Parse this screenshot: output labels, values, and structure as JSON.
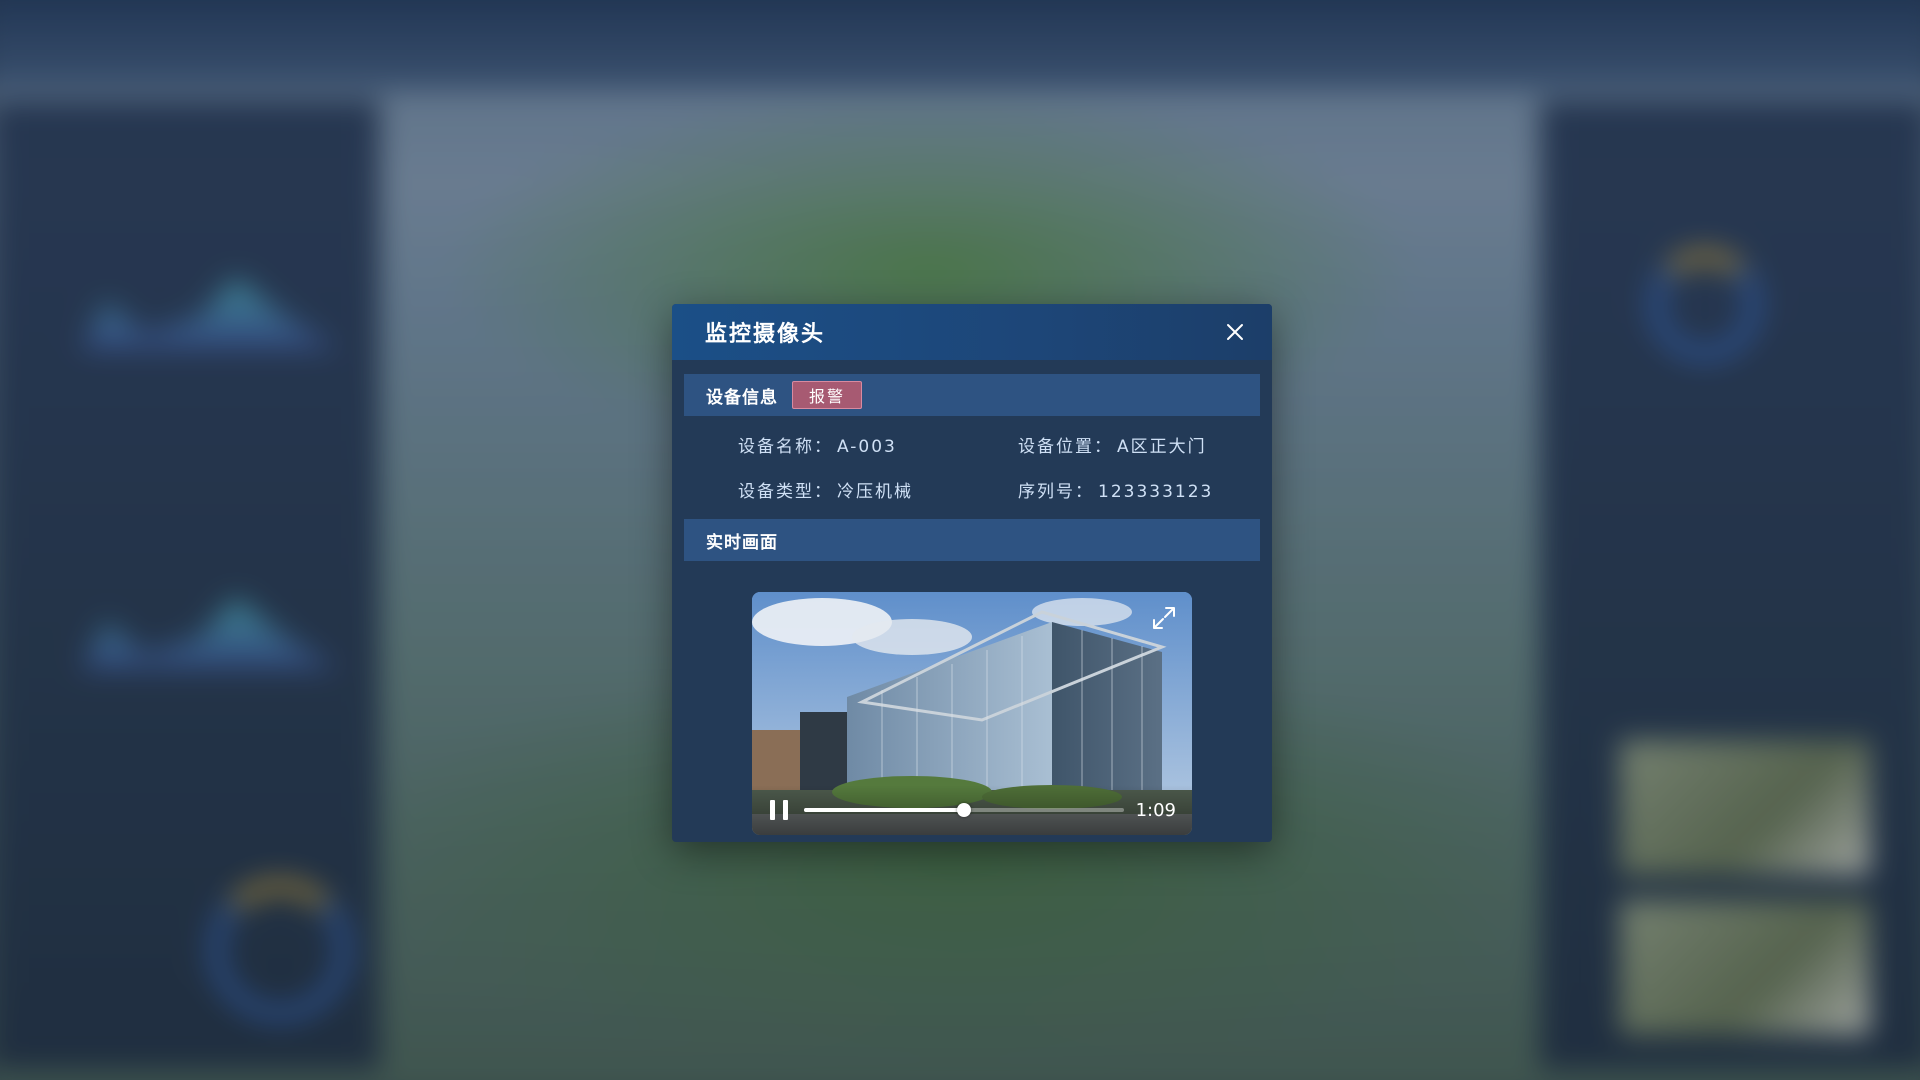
{
  "modal": {
    "title": "监控摄像头",
    "close_icon": "close-icon"
  },
  "device_info": {
    "section_label": "设备信息",
    "status_badge": "报警",
    "status_color": "#a75a72",
    "fields": {
      "name_label": "设备名称：",
      "name_value": "A-003",
      "location_label": "设备位置：",
      "location_value": "A区正大门",
      "type_label": "设备类型：",
      "type_value": "冷压机械",
      "serial_label": "序列号：",
      "serial_value": "123333123"
    }
  },
  "live_view": {
    "section_label": "实时画面",
    "player": {
      "state": "playing",
      "pause_icon": "pause-icon",
      "fullscreen_icon": "fullscreen-icon",
      "progress_fraction": 0.5,
      "time": "1:09"
    }
  },
  "colors": {
    "header_bg": "#1d4678",
    "section_bg": "#2e5382",
    "modal_bg": "#233a57"
  }
}
